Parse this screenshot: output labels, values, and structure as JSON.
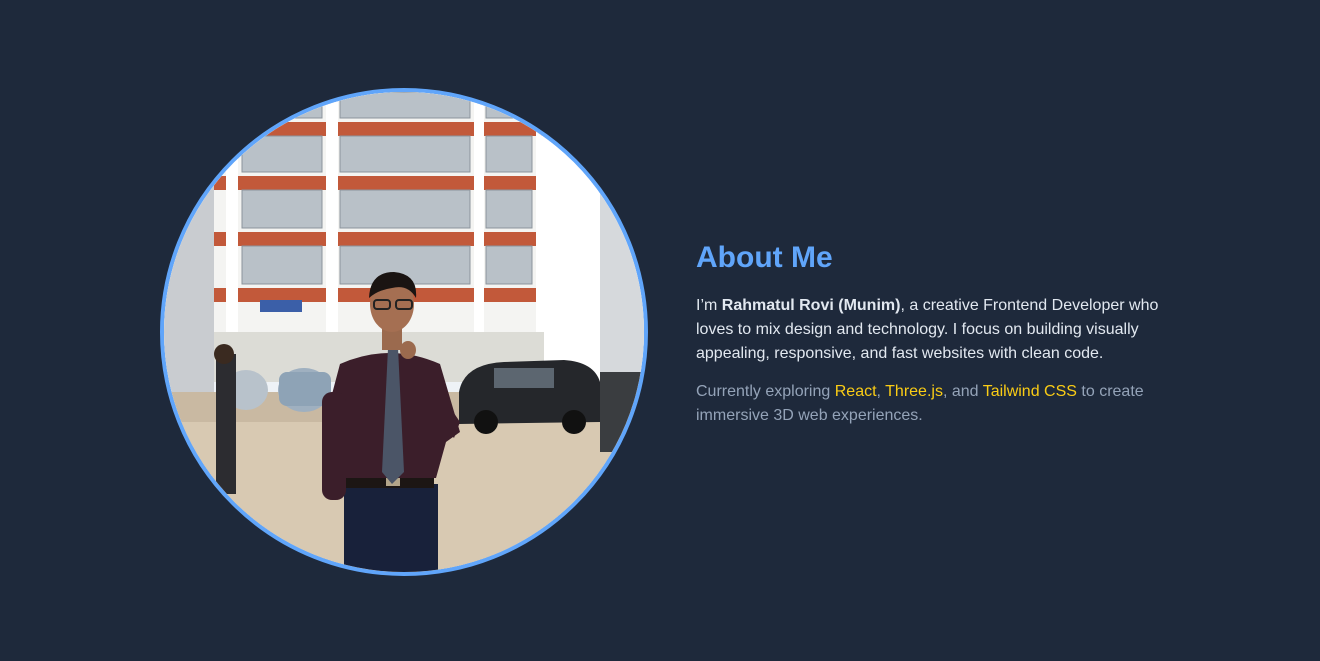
{
  "about": {
    "title": "About Me",
    "bio_prefix": "I’m ",
    "name": "Rahmatul Rovi (Munim)",
    "bio_suffix": ", a creative Frontend Developer who loves to mix design and technology. I focus on building visually appealing, responsive, and fast websites with clean code.",
    "explore_prefix": "Currently exploring ",
    "tech": [
      "React",
      "Three.js",
      "Tailwind CSS"
    ],
    "sep1": ", ",
    "sep2": ", and ",
    "explore_suffix": " to create immersive 3D web experiences."
  },
  "profile_image": {
    "alt": "Rahmatul Rovi (Munim)"
  },
  "colors": {
    "background": "#1e293b",
    "accent": "#60a5fa",
    "highlight": "#facc15",
    "text": "#e2e8f0",
    "muted": "#94a3b8"
  }
}
